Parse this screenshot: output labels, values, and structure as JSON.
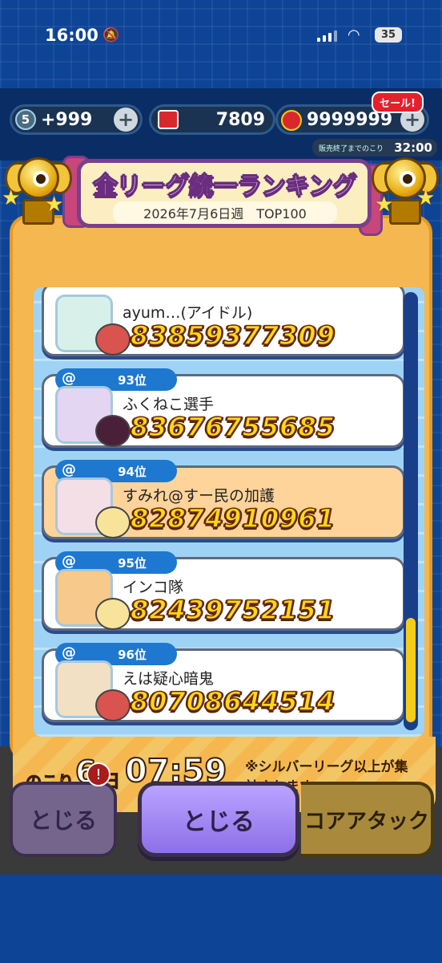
{
  "status_bar": {
    "time": "16:00",
    "battery": "35"
  },
  "currency": {
    "gems": "5",
    "gems_extra": "+999",
    "tickets": "7809",
    "coins": "9999999",
    "sale_badge": "セール!",
    "sale_timer_label": "販売終了までのこり",
    "sale_timer": "32:00"
  },
  "ranking": {
    "title": "全リーグ統一ランキング",
    "subtitle": "2026年7月6日週　TOP100",
    "rows": [
      {
        "rank": "",
        "name": "ayum…(アイドル)",
        "score": "83859377309",
        "highlight": false
      },
      {
        "rank": "93位",
        "name": "ふくねこ選手",
        "score": "83676755685",
        "highlight": false
      },
      {
        "rank": "94位",
        "name": "すみれ@すー民の加護",
        "score": "82874910961",
        "highlight": true
      },
      {
        "rank": "95位",
        "name": "インコ隊",
        "score": "82439752151",
        "highlight": false
      },
      {
        "rank": "96位",
        "name": "えは疑心暗鬼",
        "score": "80708644514",
        "highlight": false
      }
    ],
    "remaining_label": "のこり",
    "remaining_days": "6",
    "remaining_day_unit": "日",
    "remaining_time": "07:59",
    "note": "※シルバーリーグ以上が集計されます"
  },
  "buttons": {
    "left_close": "とじる",
    "center_close": "とじる",
    "score_attack": "コアアタック!",
    "notif": "!"
  },
  "colors": {
    "accent": "#f5b74f",
    "score_fill": "#ffd81a",
    "badge_blue": "#1e78d0",
    "button_purple": "#8d6fe8"
  }
}
